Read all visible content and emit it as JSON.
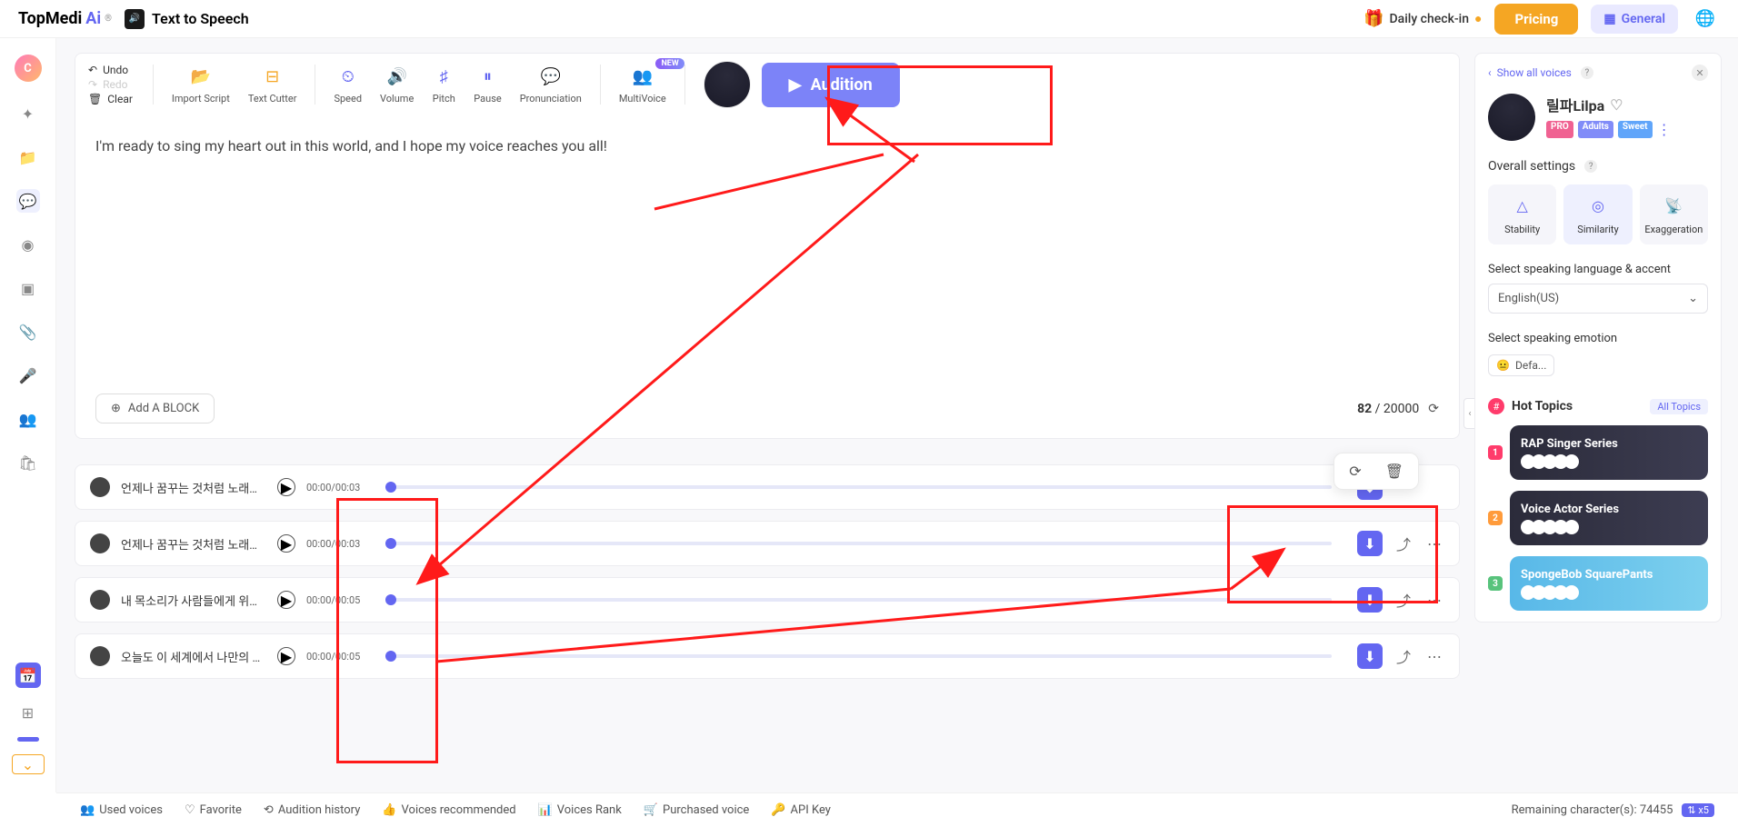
{
  "header": {
    "logo_main": "TopMedi",
    "logo_ai": "Ai",
    "tts_label": "Text to Speech",
    "checkin_label": "Daily check-in",
    "pricing_label": "Pricing",
    "general_label": "General"
  },
  "rail": {
    "avatar_initial": "C"
  },
  "toolbar": {
    "undo": "Undo",
    "redo": "Redo",
    "clear": "Clear",
    "import_script": "Import Script",
    "text_cutter": "Text Cutter",
    "speed": "Speed",
    "volume": "Volume",
    "pitch": "Pitch",
    "pause": "Pause",
    "pronunciation": "Pronunciation",
    "multivoice": "MultiVoice",
    "new_badge": "NEW",
    "audition": "Audition"
  },
  "editor": {
    "text": "I'm ready to sing my heart out in this world, and I hope my voice reaches you all!",
    "add_block": "Add A BLOCK",
    "chars_used": "82",
    "chars_sep": " / ",
    "chars_max": "20000"
  },
  "tracks": [
    {
      "title": "언제나 꿈꾸는 것처럼 노래를...",
      "time": "00:00/00:03"
    },
    {
      "title": "언제나 꿈꾸는 것처럼 노래를...",
      "time": "00:00/00:03"
    },
    {
      "title": "내 목소리가 사람들에게 위로...",
      "time": "00:00/00:05"
    },
    {
      "title": "오늘도 이 세계에서 나만의 목...",
      "time": "00:00/00:05"
    }
  ],
  "right": {
    "show_all": "Show all voices",
    "voice_name": "릴파Lilpa",
    "tag_pro": "PRO",
    "tag_adults": "Adults",
    "tag_sweet": "Sweet",
    "overall": "Overall settings",
    "stability": "Stability",
    "similarity": "Similarity",
    "exaggeration": "Exaggeration",
    "spk_lang": "Select speaking language & accent",
    "lang_value": "English(US)",
    "spk_emotion": "Select speaking emotion",
    "emotion_value": "Defa...",
    "hot_title": "Hot Topics",
    "all_topics": "All Topics",
    "topics": [
      "RAP Singer Series",
      "Voice Actor Series",
      "SpongeBob SquarePants"
    ]
  },
  "footer": {
    "used_voices": "Used voices",
    "favorite": "Favorite",
    "audition_history": "Audition history",
    "voices_recommended": "Voices recommended",
    "voices_rank": "Voices Rank",
    "purchased": "Purchased voice",
    "api_key": "API Key",
    "remaining_label": "Remaining character(s): ",
    "remaining_value": "74455",
    "multiplier": "⇅ x5"
  }
}
